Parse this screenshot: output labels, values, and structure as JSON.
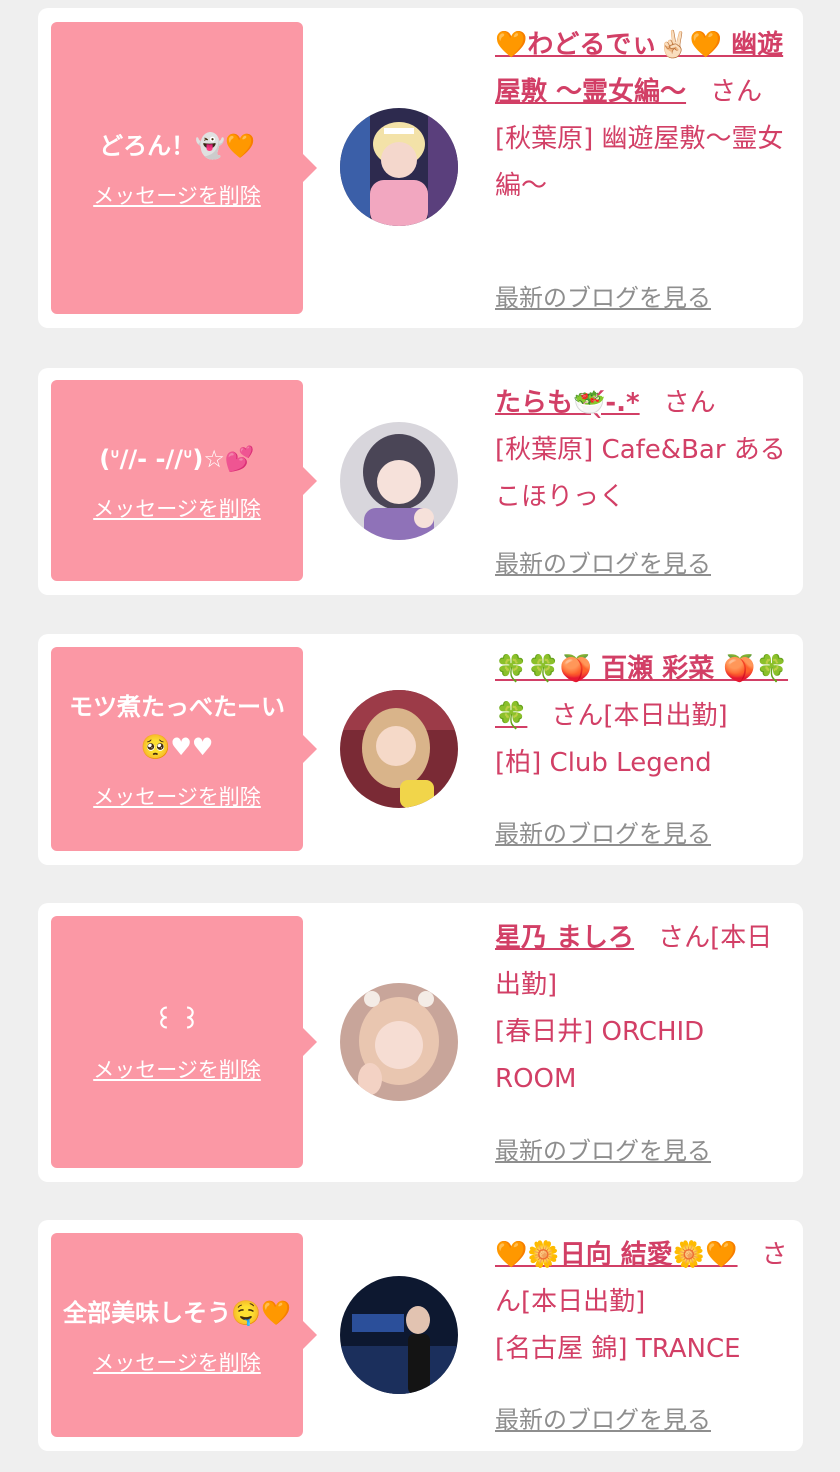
{
  "cards": [
    {
      "message": "どろん！👻🧡",
      "delete_label": "メッセージを削除",
      "cast_name": "🧡わどるでぃ✌🏻🧡 幽遊屋敷 〜霊女編〜",
      "san": "さん",
      "shop": "[秋葉原] 幽遊屋敷〜霊女編〜",
      "blog_label": "最新のブログを見る"
    },
    {
      "message": "(ᐡ//- -//ᐡ)☆💕",
      "delete_label": "メッセージを削除",
      "cast_name": "たらも🥗̖́-.*",
      "san": "さん",
      "shop": "[秋葉原] Cafe&Bar あるこほりっく",
      "blog_label": "最新のブログを見る"
    },
    {
      "message": "モツ煮たっべたーい🥺♥♥",
      "delete_label": "メッセージを削除",
      "cast_name": "🍀🍀🍑 百瀬 彩菜 🍑🍀🍀",
      "san": "さん[本日出勤]",
      "shop": "[柏] Club Legend",
      "blog_label": "最新のブログを見る"
    },
    {
      "message": "꒰ ꒱",
      "delete_label": "メッセージを削除",
      "cast_name": "星乃 ましろ",
      "san": "さん[本日出勤]",
      "shop": "[春日井] ORCHID ROOM",
      "blog_label": "最新のブログを見る"
    },
    {
      "message": "全部美味しそう🤤🧡",
      "delete_label": "メッセージを削除",
      "cast_name": "🧡🌼日向 結愛🌼🧡",
      "san": "さん[本日出勤]",
      "shop": "[名古屋 錦] TRANCE",
      "blog_label": "最新のブログを見る"
    }
  ],
  "colors": {
    "page_bg": "#efefef",
    "card_bg": "#ffffff",
    "bubble_bg": "#fb98a5",
    "accent_text": "#d23f66",
    "link_gray": "#8e8e8e"
  }
}
